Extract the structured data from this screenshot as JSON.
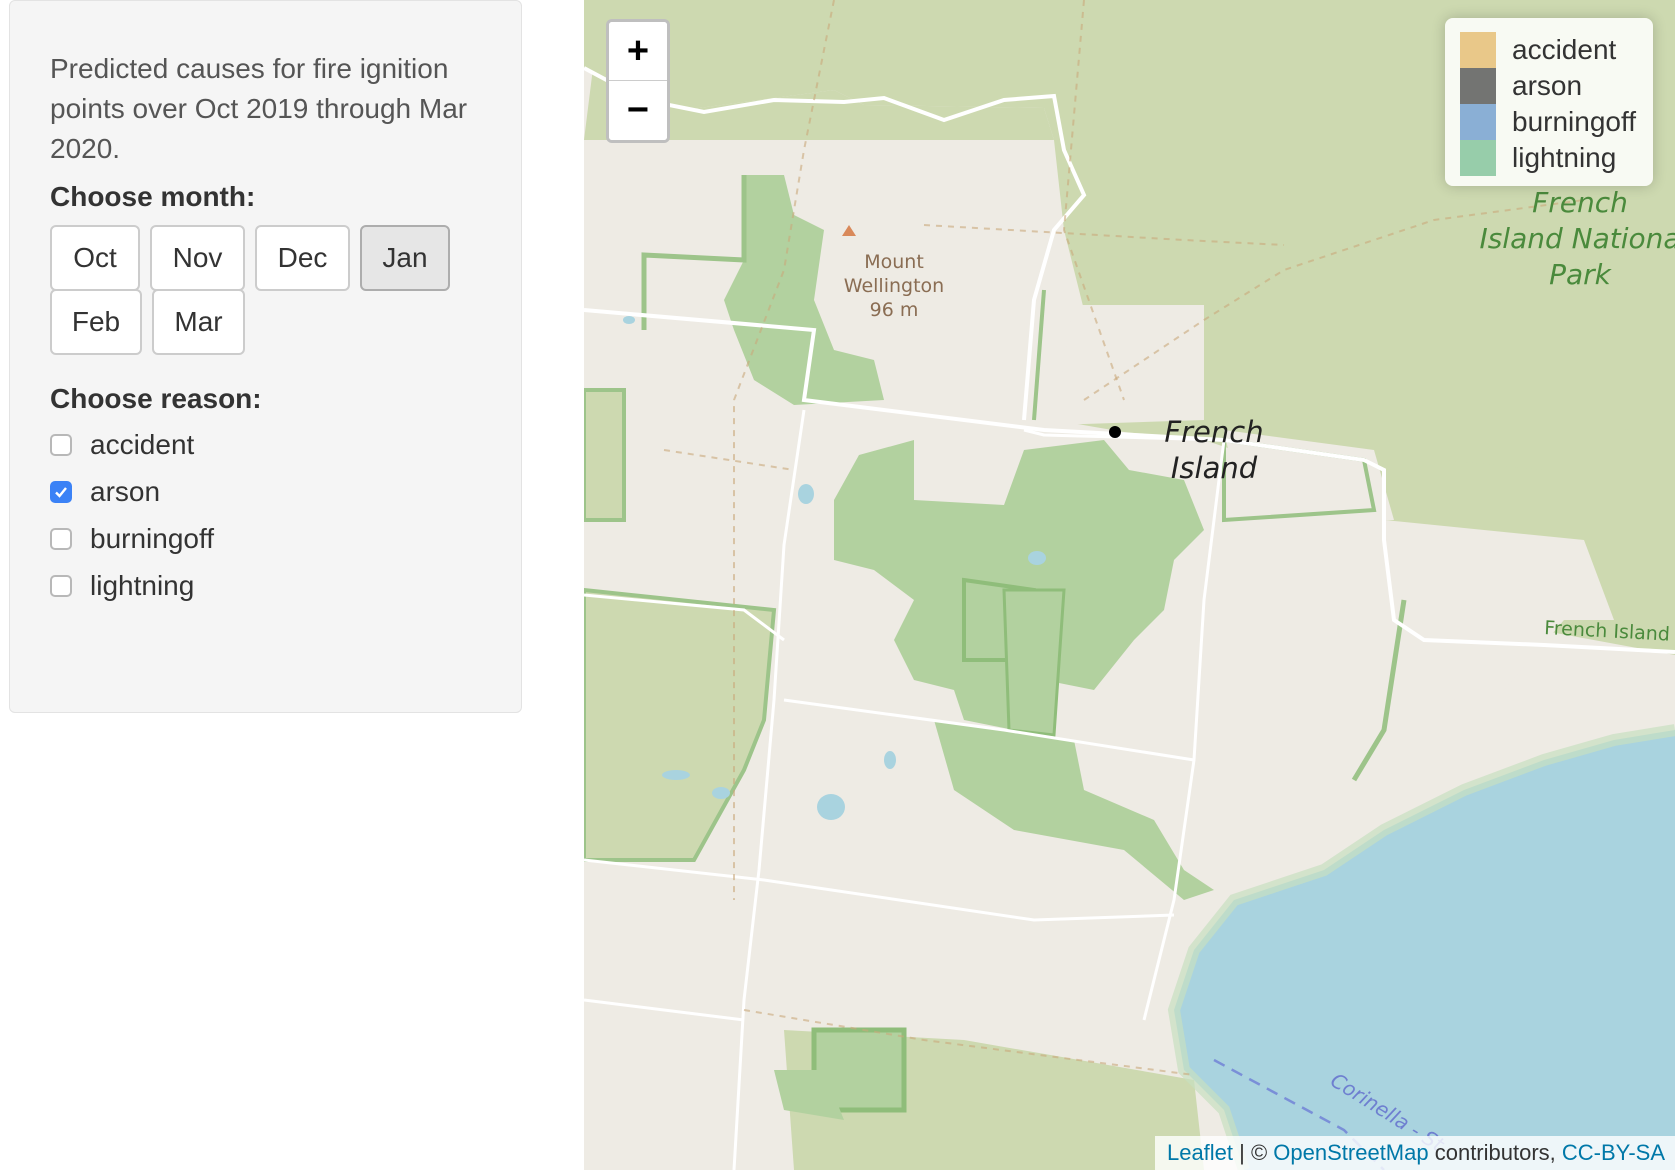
{
  "sidebar": {
    "description": "Predicted causes for fire ignition points over Oct 2019 through Mar 2020.",
    "month_label": "Choose month:",
    "months": [
      {
        "label": "Oct",
        "active": false
      },
      {
        "label": "Nov",
        "active": false
      },
      {
        "label": "Dec",
        "active": false
      },
      {
        "label": "Jan",
        "active": true
      },
      {
        "label": "Feb",
        "active": false
      },
      {
        "label": "Mar",
        "active": false
      }
    ],
    "reason_label": "Choose reason:",
    "reasons": [
      {
        "label": "accident",
        "checked": false
      },
      {
        "label": "arson",
        "checked": true
      },
      {
        "label": "burningoff",
        "checked": false
      },
      {
        "label": "lightning",
        "checked": false
      }
    ]
  },
  "map": {
    "zoom_in": "+",
    "zoom_out": "−",
    "legend": [
      {
        "label": "accident",
        "color": "#e3b25b"
      },
      {
        "label": "arson",
        "color": "#3a3a3a"
      },
      {
        "label": "burningoff",
        "color": "#5b8fc7"
      },
      {
        "label": "lightning",
        "color": "#6db98a"
      }
    ],
    "labels": {
      "mount_line1": "Mount",
      "mount_line2": "Wellington",
      "mount_line3": "96 m",
      "island_line1": "French",
      "island_line2": "Island",
      "park_line1": "French",
      "park_line2": "Island Nationa",
      "park_line3": "Park",
      "road": "French Island I",
      "strait": "Corinella - St"
    },
    "attribution": {
      "leaflet": "Leaflet",
      "sep": " | © ",
      "osm": "OpenStreetMap",
      "contributors": " contributors, ",
      "license": "CC-BY-SA"
    },
    "colors": {
      "background": "#eeebe4",
      "park": "#cdd9b0",
      "forest": "#b2d19f",
      "water": "#a9d3df"
    }
  }
}
